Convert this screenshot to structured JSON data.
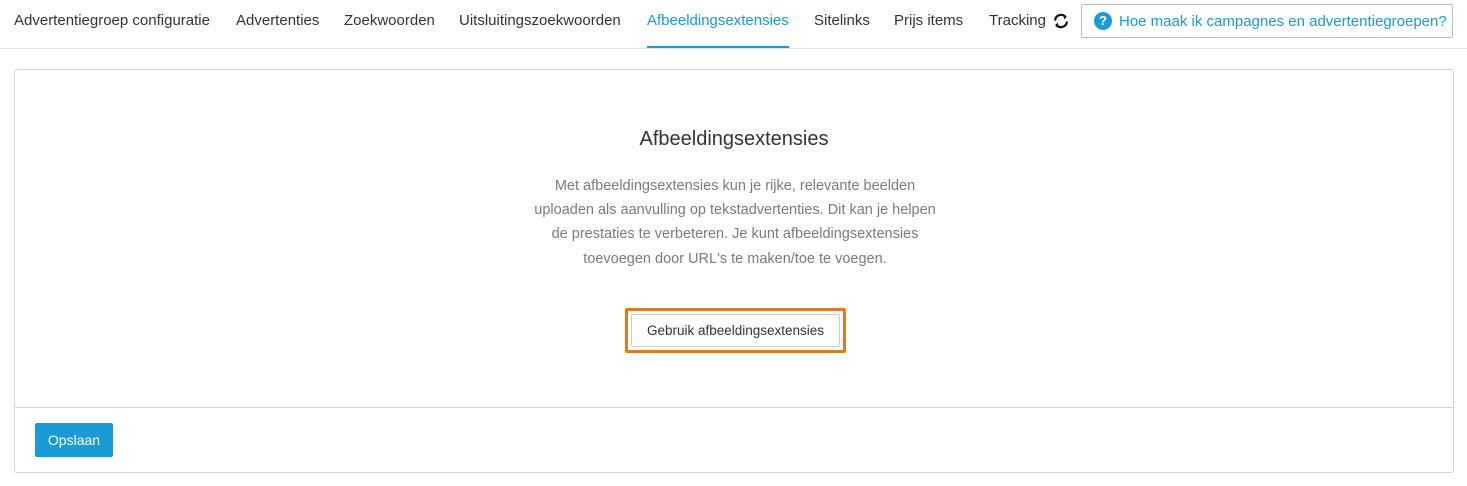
{
  "tabs": [
    {
      "label": "Advertentiegroep configuratie",
      "active": false
    },
    {
      "label": "Advertenties",
      "active": false
    },
    {
      "label": "Zoekwoorden",
      "active": false
    },
    {
      "label": "Uitsluitingszoekwoorden",
      "active": false
    },
    {
      "label": "Afbeeldingsextensies",
      "active": true
    },
    {
      "label": "Sitelinks",
      "active": false
    },
    {
      "label": "Prijs items",
      "active": false
    },
    {
      "label": "Tracking",
      "active": false
    }
  ],
  "toolbar": {
    "refresh_icon": "refresh-icon",
    "help_icon": "question-circle-icon",
    "help_label": "Hoe maak ik campagnes en advertentiegroepen?"
  },
  "panel": {
    "title": "Afbeeldingsextensies",
    "description": "Met afbeeldingsextensies kun je rijke, relevante beelden uploaden als aanvulling op tekstadvertenties. Dit kan je helpen de prestaties te verbeteren. Je kunt afbeeldingsextensies toevoegen door URL's te maken/toe te voegen.",
    "cta_label": "Gebruik afbeeldingsextensies"
  },
  "footer": {
    "save_label": "Opslaan"
  },
  "colors": {
    "accent": "#1a9ad6",
    "highlight": "#e07b24",
    "muted_text": "#7a7a7a",
    "border": "#d4d4d4"
  }
}
